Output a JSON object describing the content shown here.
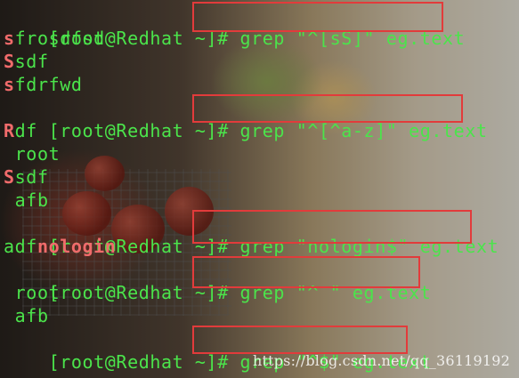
{
  "terminal": {
    "prompt": "[root@Redhat ~]#",
    "commands": [
      "grep \"^[sS]\" eg.text",
      "grep \"^[^a-z]\" eg.text",
      "grep \"nologin$\" eg.text",
      "grep \"^ \" eg.text",
      "grep \"^$\" eg.text"
    ],
    "outputs": {
      "block1": [
        {
          "m": "s",
          "r": "frosdfsd"
        },
        {
          "m": "S",
          "r": "sdf"
        },
        {
          "m": "s",
          "r": "fdrfwd"
        }
      ],
      "block2": [
        {
          "m": "R",
          "r": "df"
        },
        {
          "m": " ",
          "r": "root"
        },
        {
          "m": "S",
          "r": "sdf"
        },
        {
          "m": " ",
          "r": "afb"
        }
      ],
      "block3": [
        {
          "p": "adf",
          "m": "nologin"
        }
      ],
      "block4": [
        {
          "m": " ",
          "r": "root"
        },
        {
          "m": " ",
          "r": "afb"
        }
      ]
    }
  },
  "watermark": "https://blog.csdn.net/qq_36119192",
  "colors": {
    "terminal_text": "#4be44b",
    "match_text": "#f06b6b",
    "highlight_box": "#e23b3b"
  }
}
